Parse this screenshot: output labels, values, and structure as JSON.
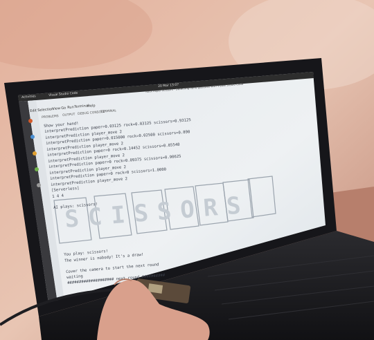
{
  "topbar": {
    "activities": "Activities",
    "app_name": "Visual Studio Code",
    "clock": "20 Mar 13:07",
    "window_title": "Rock Paper Scissors - Detecting hand gestures with Visual Studio Code"
  },
  "menu": [
    "Edit",
    "Selection",
    "View",
    "Go",
    "Run",
    "Terminal",
    "Help"
  ],
  "panel_tabs": [
    "PROBLEMS",
    "OUTPUT",
    "DEBUG CONSOLE",
    "TERMINAL"
  ],
  "terminal": {
    "lines": [
      "Show your hand!",
      "interpretPrediction  paper=0.03125 rock=0.03125 scissors=0.93125",
      "interpretPrediction  player_move  2",
      "interpretPrediction  paper=0.015000 rock=0.02500 scissors=0.890",
      "interpretPrediction  player_move  2",
      "interpretPrediction  paper=0 rock=0.14452 scissors=0.85548",
      "interpretPrediction  player_move  2",
      "interpretPrediction  paper=0 rock=0.09375 scissors=0.90625",
      "interpretPrediction  player_move  2",
      "interpretPrediction  paper=0 rock=0 scissors=1.0000",
      "interpretPrediction  player_move  2",
      "[Serverless]",
      "1 4 4",
      "",
      "AI plays: scissors!"
    ],
    "banner": "SCISSORS",
    "tail": [
      "You play: scissors!",
      "The winner is nobody! It's a draw!",
      "",
      "Cover the camera to start the next round",
      "waiting",
      "#################### next round ##########"
    ]
  }
}
